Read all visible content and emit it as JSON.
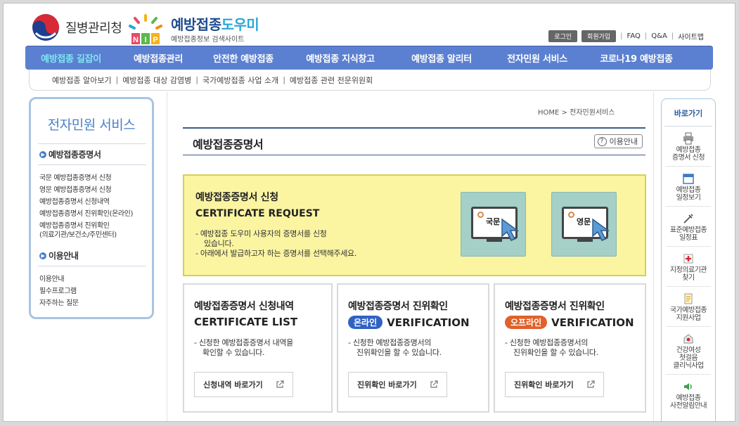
{
  "header": {
    "gov_name": "질병관리청",
    "site_title_main": "예방접종",
    "site_title_accent": "도우미",
    "site_subtitle": "예방접종정보 검색사이트",
    "logo_letters": "NIP",
    "util": {
      "login": "로그인",
      "join": "회원가입",
      "faq": "FAQ",
      "qna": "Q&A",
      "sitemap": "사이트맵"
    }
  },
  "gnb": [
    {
      "label": "예방접종 길잡이",
      "active": true
    },
    {
      "label": "예방접종관리",
      "active": false
    },
    {
      "label": "안전한 예방접종",
      "active": false
    },
    {
      "label": "예방접종 지식창고",
      "active": false
    },
    {
      "label": "예방접종 알리터",
      "active": false
    },
    {
      "label": "전자민원 서비스",
      "active": false
    },
    {
      "label": "코로나19 예방접종",
      "active": false
    }
  ],
  "subnav": [
    "예방접종 알아보기",
    "예방접종 대상 감염병",
    "국가예방접종 사업 소개",
    "예방접종 관련 전문위원회"
  ],
  "sidebar": {
    "title": "전자민원 서비스",
    "section1": "예방접종증명서",
    "items1": [
      "국문 예방접종증명서 신청",
      "영문 예방접종증명서 신청",
      "예방접종증명서 신청내역",
      "예방접종증명서 진위확인(온라인)",
      "예방접종증명서 진위확인",
      "(의료기관/보건소/주민센터)"
    ],
    "section2": "이용안내",
    "items2": [
      "이용안내",
      "필수프로그램",
      "자주하는 질문"
    ]
  },
  "breadcrumb": {
    "home": "HOME",
    "sep": ">",
    "current": "전자민원서비스"
  },
  "page": {
    "title": "예방접종증명서",
    "guide_button": "이용안내",
    "guide_icon_glyph": "?"
  },
  "request": {
    "title": "예방접종증명서 신청",
    "title_en": "CERTIFICATE REQUEST",
    "desc1": "- 예방접종 도우미 사용자의 증명서를 신청",
    "desc2": "  있습니다.",
    "desc3": "- 아래에서 발급하고자 하는 증명서를 선택해주세요.",
    "tile_kr": "국문",
    "tile_en": "영문",
    "tile_color": "#a4d0c8"
  },
  "cards": [
    {
      "title": "예방접종증명서 신청내역",
      "tag": "",
      "title_en": "CERTIFICATE LIST",
      "desc1": "- 신청한 예방접종증명서 내역을",
      "desc2": "  확인할 수 있습니다.",
      "button": "신청내역 바로가기"
    },
    {
      "title": "예방접종증명서 진위확인",
      "tag": "온라인",
      "tag_color": "#2f62c4",
      "title_en": "VERIFICATION",
      "desc1": "- 신청한 예방접종증명서의",
      "desc2": "  진위확인을 할 수 있습니다.",
      "button": "진위확인 바로가기"
    },
    {
      "title": "예방접종증명서 진위확인",
      "tag": "오프라인",
      "tag_color": "#e0612a",
      "title_en": "VERIFICATION",
      "desc1": "- 신청한 예방접종증명서의",
      "desc2": "  진위확인을 할 수 있습니다.",
      "button": "진위확인 바로가기"
    }
  ],
  "quick": {
    "title": "바로가기",
    "items": [
      {
        "l1": "예방접종",
        "l2": "증명서 신청",
        "icon": "printer-icon"
      },
      {
        "l1": "예방접종",
        "l2": "일정보기",
        "icon": "calendar-icon"
      },
      {
        "l1": "표준예방접종",
        "l2": "일정표",
        "icon": "syringe-icon"
      },
      {
        "l1": "지정의료기관",
        "l2": "찾기",
        "icon": "hospital-icon"
      },
      {
        "l1": "국가예방접종",
        "l2": "지원사업",
        "icon": "document-icon"
      },
      {
        "l1": "건강여성",
        "l2": "첫걸음",
        "l3": "클리닉사업",
        "icon": "clinic-icon"
      },
      {
        "l1": "예방접종",
        "l2": "사전알림안내",
        "icon": "speaker-icon"
      }
    ]
  },
  "colors": {
    "gnb": "#5b80d1",
    "gnb_active": "#7fe6f2",
    "request_bg": "#fbf5a2",
    "sidebar_border": "#a8c4e2"
  }
}
